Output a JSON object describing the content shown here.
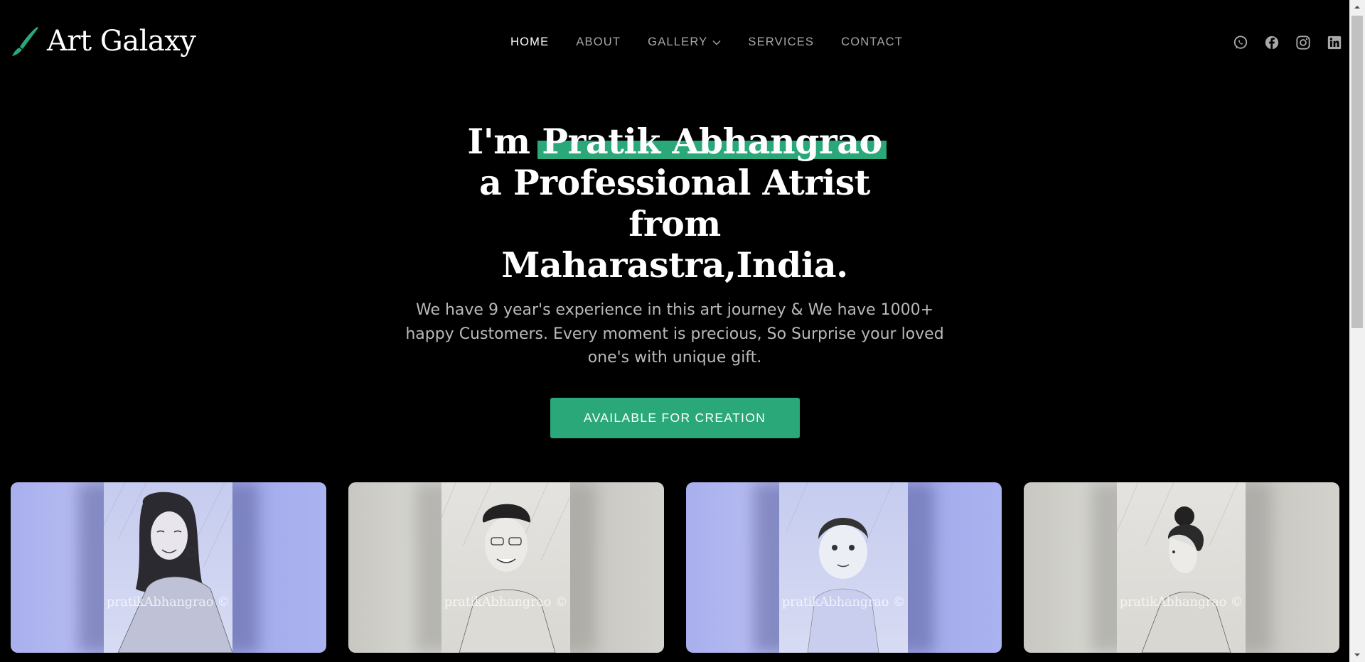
{
  "brand": {
    "name": "Art Galaxy",
    "accent": "#2aa87a"
  },
  "nav": {
    "items": [
      {
        "label": "HOME",
        "active": true
      },
      {
        "label": "ABOUT"
      },
      {
        "label": "GALLERY",
        "dropdown": true
      },
      {
        "label": "SERVICES"
      },
      {
        "label": "CONTACT"
      }
    ]
  },
  "social": [
    "whatsapp-icon",
    "facebook-icon",
    "instagram-icon",
    "linkedin-icon"
  ],
  "hero": {
    "title_prefix": "I'm ",
    "title_highlight": "Pratik Abhangrao",
    "title_suffix": " a Professional Atrist from Maharastra,India.",
    "description": "We have 9 year's experience in this art journey & We have 1000+ happy Customers. Every moment is precious, So Surprise your loved one's with unique gift.",
    "cta_label": "AVAILABLE FOR CREATION"
  },
  "gallery": {
    "watermark": "pratikAbhangrao ©",
    "cards": [
      {
        "tone": "blue",
        "subject": "woman-portrait"
      },
      {
        "tone": "gray",
        "subject": "man-portrait"
      },
      {
        "tone": "blue",
        "subject": "child-portrait"
      },
      {
        "tone": "gray",
        "subject": "woman-profile-portrait"
      }
    ]
  }
}
